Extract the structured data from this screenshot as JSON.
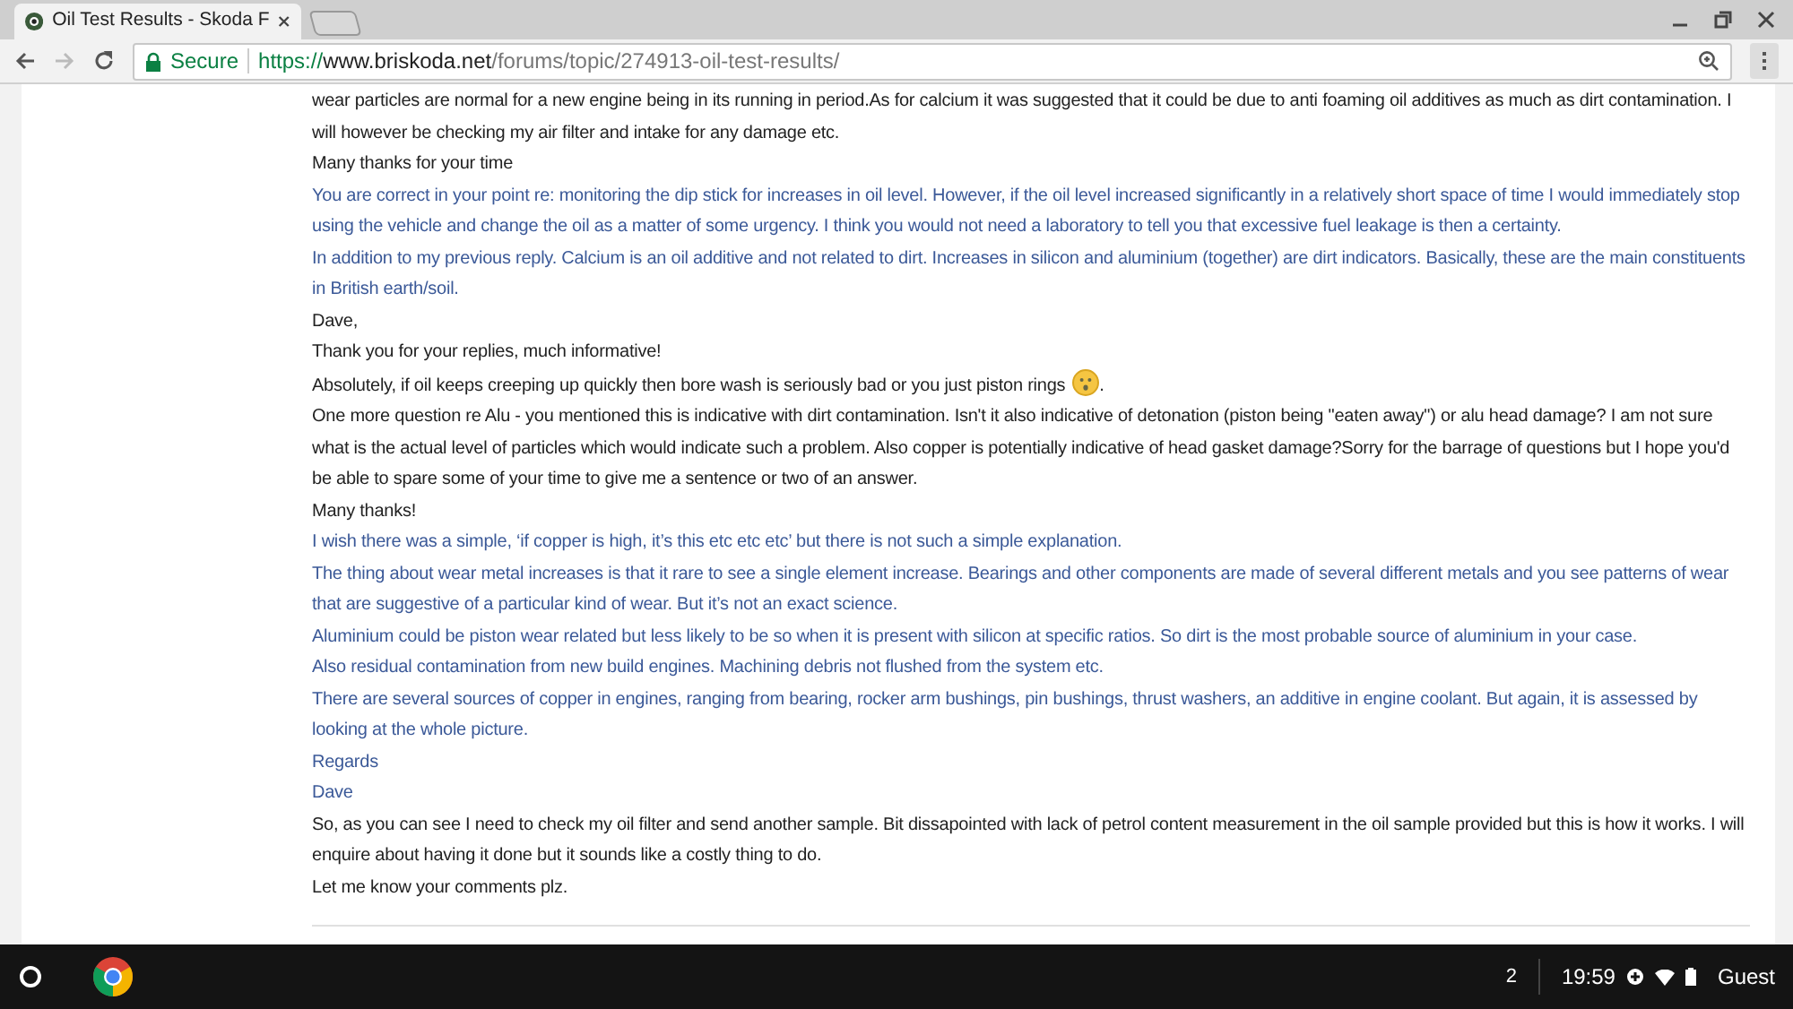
{
  "tab": {
    "title": "Oil Test Results - Skoda F",
    "selected": true
  },
  "address_bar": {
    "security": "Secure",
    "scheme": "https://",
    "host": "www.briskoda.net",
    "path": "/forums/topic/274913-oil-test-results/"
  },
  "post": [
    {
      "kind": "reply",
      "text": "wear particles are normal for a new engine being in its running in period.As for calcium it was suggested that it could be due to anti foaming oil additives as much as dirt contamination. I will however be checking my air filter and intake for any damage etc."
    },
    {
      "kind": "reply",
      "text": "Many thanks for your time"
    },
    {
      "kind": "quote",
      "text": "You are correct in your point re: monitoring the dip stick for increases in oil level. However, if the oil level increased significantly in a relatively short space of time I would immediately stop using the vehicle and change the oil as a matter of some urgency. I think you would not need a laboratory to tell you that excessive fuel leakage is then a certainty."
    },
    {
      "kind": "quote",
      "text": "In addition to my previous reply. Calcium is an oil additive and not related to dirt. Increases in silicon and aluminium (together) are dirt indicators. Basically, these are the main constituents in British earth/soil."
    },
    {
      "kind": "reply",
      "text": "Dave,"
    },
    {
      "kind": "reply",
      "text": "Thank you for your replies, much informative!"
    },
    {
      "kind": "reply",
      "text": "Absolutely, if oil keeps creeping up quickly then bore wash is seriously bad or you just piston rings",
      "emoji": true,
      "tail": "."
    },
    {
      "kind": "reply",
      "text": "One more question re Alu - you mentioned this is indicative with dirt contamination. Isn't it also indicative of detonation (piston being \"eaten away\") or alu head damage? I am not sure what is the actual level of particles which would indicate such a problem. Also copper is potentially indicative of head gasket damage?Sorry for the barrage of questions but I hope you'd be able to spare some of your time to give me a sentence or two of an answer."
    },
    {
      "kind": "reply",
      "text": "Many thanks!"
    },
    {
      "kind": "quote",
      "text": "I wish there was a simple, ‘if copper is high, it’s this etc etc etc’ but there is not such a simple explanation."
    },
    {
      "kind": "quote",
      "text": "The thing about wear metal increases is that it rare to see a single element increase. Bearings and other components are made of several different metals and you see patterns of wear that are suggestive of a particular kind of wear. But it’s not an exact science."
    },
    {
      "kind": "quote",
      "text": "Aluminium could be piston wear related but less likely to be so when it is present with silicon at specific ratios. So dirt is the most probable source of aluminium in your case."
    },
    {
      "kind": "quote",
      "text": "Also residual contamination from new build engines. Machining debris not flushed from the system etc."
    },
    {
      "kind": "quote",
      "text": "There are several sources of copper in engines, ranging from bearing, rocker arm bushings, pin bushings, thrust washers, an additive in engine coolant. But again, it is assessed by looking at the whole picture."
    },
    {
      "kind": "quote",
      "text": "Regards"
    },
    {
      "kind": "quote",
      "text": "Dave"
    },
    {
      "kind": "reply",
      "text": "So, as you can see I need to check my oil filter and send another sample. Bit dissapointed with lack of petrol content measurement in the oil sample provided but this is how it works. I will enquire about having it done but it sounds like a costly thing to do."
    },
    {
      "kind": "reply",
      "text": "Let me know your comments plz."
    }
  ],
  "taskbar": {
    "notification_count": "2",
    "time": "19:59",
    "user": "Guest"
  }
}
